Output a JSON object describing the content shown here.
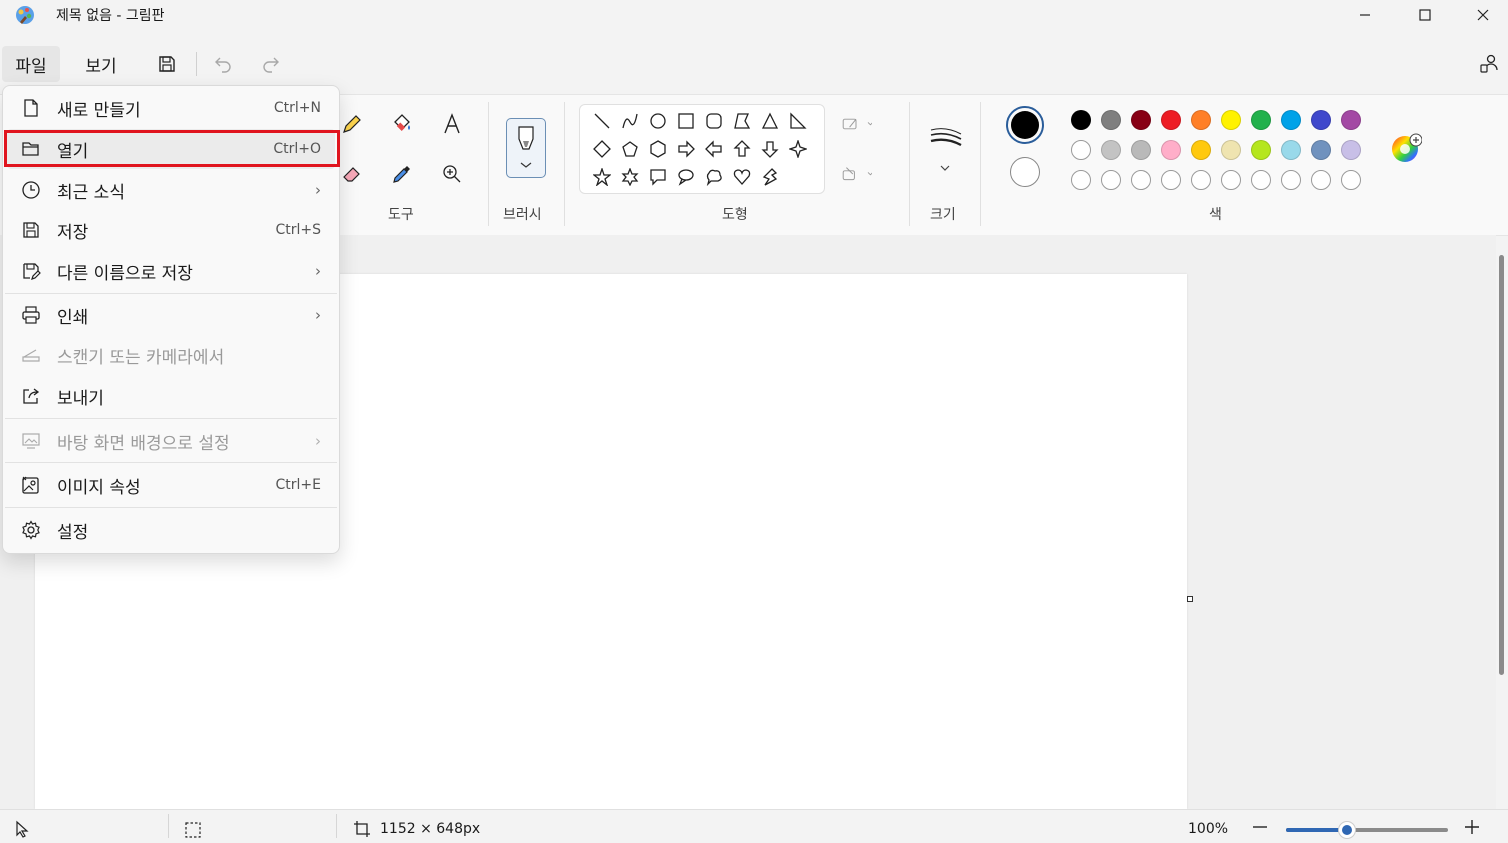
{
  "window": {
    "title": "제목 없음 - 그림판",
    "minimize_icon": "minimize-icon",
    "maximize_icon": "maximize-icon",
    "close_icon": "close-icon"
  },
  "menubar": {
    "file_label": "파일",
    "view_label": "보기",
    "save_icon": "save-icon",
    "undo_icon": "undo-icon",
    "redo_icon": "redo-icon",
    "account_icon": "account-icon"
  },
  "ribbon": {
    "tools_label": "도구",
    "brushes_label": "브러시",
    "shapes_label": "도형",
    "size_label": "크기",
    "colors_label": "색"
  },
  "colors": {
    "row1": [
      "#000000",
      "#7f7f7f",
      "#880015",
      "#ed1c24",
      "#ff7f27",
      "#fff200",
      "#22b14c",
      "#00a2e8",
      "#3f48cc",
      "#a349a4"
    ],
    "row2": [
      "#ffffff",
      "#c3c3c3",
      "#b9b9b9",
      "#ffaec9",
      "#ffc90e",
      "#efe4b0",
      "#b5e61d",
      "#99d9ea",
      "#7092be",
      "#c8bfe7"
    ],
    "primary": "#000000",
    "secondary": "#ffffff"
  },
  "file_menu": {
    "items": [
      {
        "label": "새로 만들기",
        "shortcut": "Ctrl+N",
        "icon": "new-file-icon"
      },
      {
        "label": "열기",
        "shortcut": "Ctrl+O",
        "icon": "open-folder-icon"
      },
      {
        "label": "최근 소식",
        "shortcut": "",
        "icon": "recent-clock-icon"
      },
      {
        "label": "저장",
        "shortcut": "Ctrl+S",
        "icon": "save-icon"
      },
      {
        "label": "다른 이름으로 저장",
        "shortcut": "",
        "icon": "save-as-icon"
      },
      {
        "label": "인쇄",
        "shortcut": "",
        "icon": "print-icon"
      },
      {
        "label": "스캔기 또는 카메라에서",
        "shortcut": "",
        "icon": "scanner-icon"
      },
      {
        "label": "보내기",
        "shortcut": "",
        "icon": "share-icon"
      },
      {
        "label": "바탕 화면 배경으로 설정",
        "shortcut": "",
        "icon": "wallpaper-icon"
      },
      {
        "label": "이미지 속성",
        "shortcut": "Ctrl+E",
        "icon": "image-properties-icon"
      },
      {
        "label": "설정",
        "shortcut": "",
        "icon": "settings-gear-icon"
      }
    ]
  },
  "status": {
    "canvas_size": "1152 × 648px",
    "zoom": "100%"
  }
}
